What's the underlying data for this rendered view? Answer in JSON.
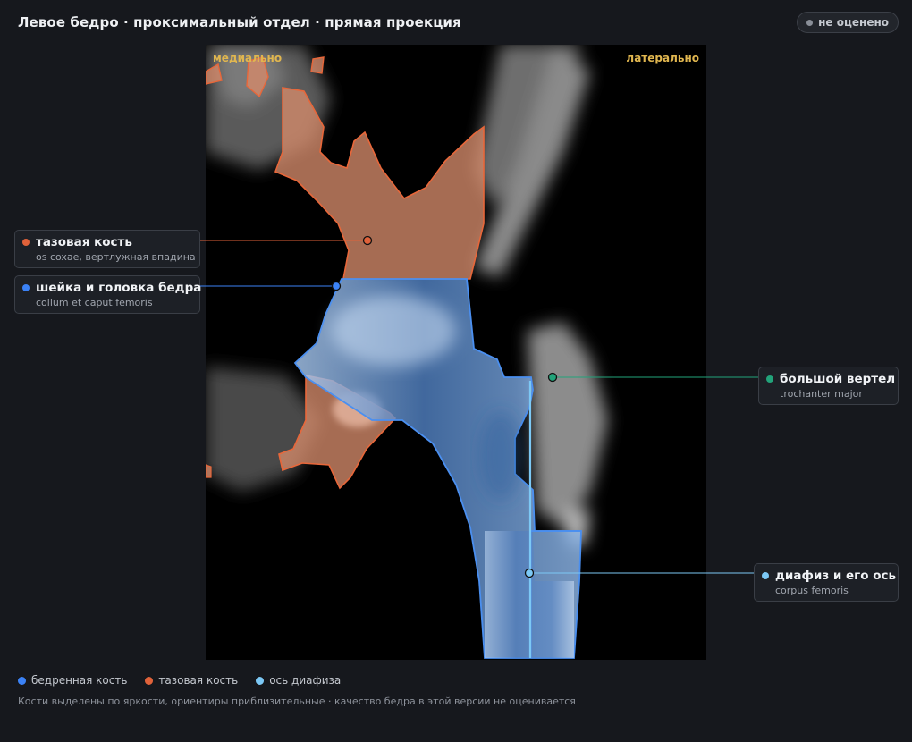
{
  "header": {
    "title": "Левое бедро · проксимальный отдел · прямая проекция",
    "status_label": "не оценено"
  },
  "viewer": {
    "orient_left": "медиально",
    "orient_right": "латерально"
  },
  "colors": {
    "femur": "#3b82f6",
    "pelvis": "#e0623a",
    "axis": "#7cc8f5",
    "trochanter": "#22a37a",
    "orientation": "#e0b64f",
    "status_dot": "#8a8f98"
  },
  "callouts": [
    {
      "name": "тазовая кость",
      "latin": "os coxae, вертлужная впадина",
      "color": "#e0623a"
    },
    {
      "name": "шейка и головка бедра",
      "latin": "collum et caput femoris",
      "color": "#3b82f6"
    },
    {
      "name": "большой вертел",
      "latin": "trochanter major",
      "color": "#22a37a"
    },
    {
      "name": "диафиз и его ось",
      "latin": "corpus femoris",
      "color": "#7cc8f5"
    }
  ],
  "legend": [
    {
      "label": "бедренная кость",
      "color": "#3b82f6"
    },
    {
      "label": "тазовая кость",
      "color": "#e0623a"
    },
    {
      "label": "ось диафиза",
      "color": "#7cc8f5"
    }
  ],
  "footnote": "Кости выделены по яркости, ориентиры приблизительные · качество бедра в этой версии не оценивается"
}
